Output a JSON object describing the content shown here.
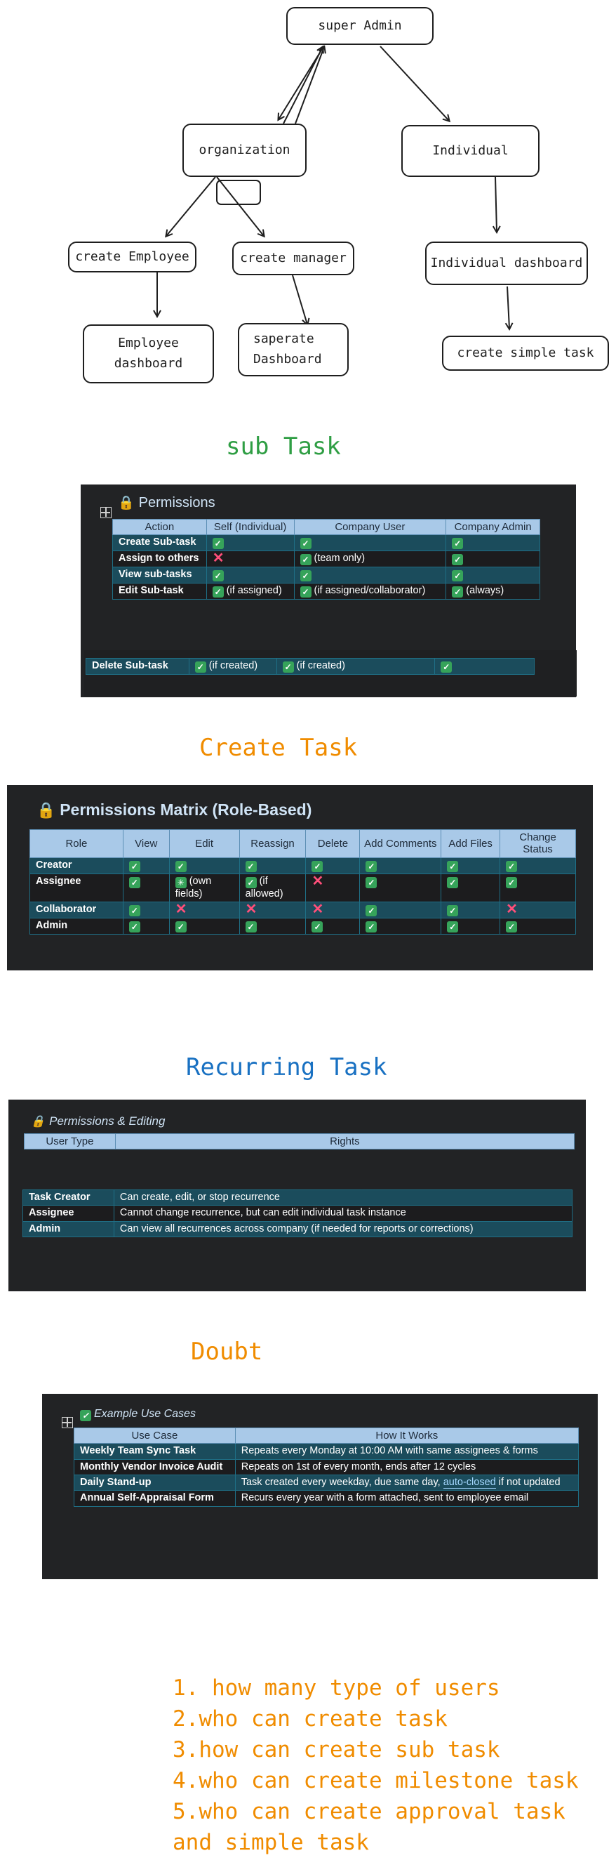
{
  "flowchart": {
    "nodes": {
      "super_admin": "super Admin",
      "organization": "organization",
      "individual": "Individual",
      "create_employee": "create Employee",
      "create_manager": "create manager",
      "individual_dashboard": "Individual dashboard",
      "employee_dashboard": "Employee\ndashboard",
      "separate_dashboard": "saperate\nDashboard",
      "create_simple_task": "create simple task"
    }
  },
  "colors": {
    "green_heading": "#2f9e44",
    "orange_heading": "#f08c00",
    "blue_heading": "#1971c2",
    "panel_bg": "#222325",
    "header_bg": "#a9c9e8",
    "teal_row": "#1b4c5c"
  },
  "subtask": {
    "heading": "sub Task",
    "title": "Permissions",
    "headers": [
      "Action",
      "Self (Individual)",
      "Company User",
      "Company Admin"
    ],
    "rows": [
      {
        "action": "Create Sub-task",
        "self": "",
        "company_user": "",
        "company_admin": ""
      },
      {
        "action": "Assign to others",
        "self": "",
        "company_user": "(team only)",
        "company_admin": ""
      },
      {
        "action": "View sub-tasks",
        "self": "",
        "company_user": "",
        "company_admin": ""
      },
      {
        "action": "Edit Sub-task",
        "self": "(if assigned)",
        "company_user": "(if assigned/collaborator)",
        "company_admin": "(always)"
      }
    ],
    "extra_row": {
      "action": "Delete Sub-task",
      "self": "(if created)",
      "company_user": "(if created)",
      "company_admin": ""
    }
  },
  "create_task": {
    "heading": "Create Task",
    "title": "Permissions Matrix (Role-Based)",
    "headers": [
      "Role",
      "View",
      "Edit",
      "Reassign",
      "Delete",
      "Add Comments",
      "Add Files",
      "Change Status"
    ],
    "rows": [
      {
        "role": "Creator",
        "edit": "",
        "reassign": ""
      },
      {
        "role": "Assignee",
        "edit": "(own fields)",
        "reassign": "(if allowed)"
      },
      {
        "role": "Collaborator",
        "edit": "",
        "reassign": ""
      },
      {
        "role": "Admin",
        "edit": "",
        "reassign": ""
      }
    ]
  },
  "recurring": {
    "heading": "Recurring Task",
    "title": "Permissions & Editing",
    "headers": [
      "User Type",
      "Rights"
    ],
    "rows": [
      {
        "type": "Task Creator",
        "rights": "Can create, edit, or stop recurrence"
      },
      {
        "type": "Assignee",
        "rights": "Cannot change recurrence, but can edit individual task instance"
      },
      {
        "type": "Admin",
        "rights": "Can view all recurrences across company (if needed for reports or corrections)"
      }
    ]
  },
  "doubt": {
    "heading": "Doubt",
    "title": "Example Use Cases",
    "headers": [
      "Use Case",
      "How It Works"
    ],
    "rows": [
      {
        "case": "Weekly Team Sync Task",
        "how": "Repeats every Monday at 10:00 AM with same assignees & forms"
      },
      {
        "case": "Monthly Vendor Invoice Audit",
        "how": "Repeats on 1st of every month, ends after 12 cycles"
      },
      {
        "case": "Daily Stand-up",
        "how_a": "Task created every weekday, due same day, ",
        "how_b": "auto-closed",
        "how_c": " if not updated"
      },
      {
        "case": "Annual Self-Appraisal Form",
        "how": "Recurs every year with a form attached, sent to employee email"
      }
    ],
    "questions": [
      "1. how many type of users",
      "2.who can create task",
      "3.how can create sub task",
      "4.who can create milestone task",
      "5.who can create approval task",
      "and simple task"
    ]
  }
}
